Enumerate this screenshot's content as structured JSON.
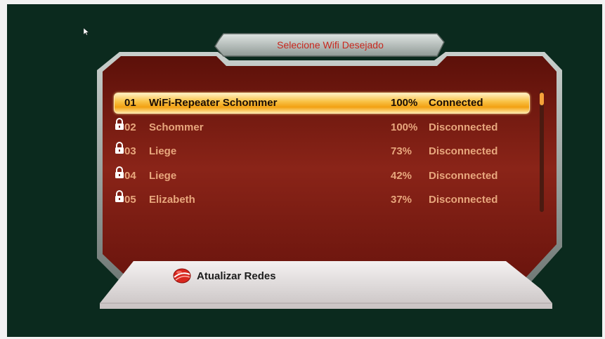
{
  "title": "Selecione Wifi Desejado",
  "networks": [
    {
      "num": "01",
      "ssid": "WiFi-Repeater Schommer",
      "locked": true,
      "signal": "100%",
      "status": "Connected",
      "selected": true
    },
    {
      "num": "02",
      "ssid": "Schommer",
      "locked": true,
      "signal": "100%",
      "status": "Disconnected",
      "selected": false
    },
    {
      "num": "03",
      "ssid": "Liege",
      "locked": true,
      "signal": "73%",
      "status": "Disconnected",
      "selected": false
    },
    {
      "num": "04",
      "ssid": "Liege",
      "locked": true,
      "signal": "42%",
      "status": "Disconnected",
      "selected": false
    },
    {
      "num": "05",
      "ssid": "Elizabeth",
      "locked": true,
      "signal": "37%",
      "status": "Disconnected",
      "selected": false
    }
  ],
  "refresh_button": {
    "label": "Atualizar Redes",
    "icon": "red-globe-icon"
  },
  "icons": {
    "lock": "padlock-icon",
    "cursor": "mouse-pointer-icon"
  },
  "colors": {
    "background": "#0b2a1e",
    "panel": "#7a1a12",
    "selection": "#f7b43a",
    "title": "#c8281e",
    "text": "#e8a77d"
  }
}
